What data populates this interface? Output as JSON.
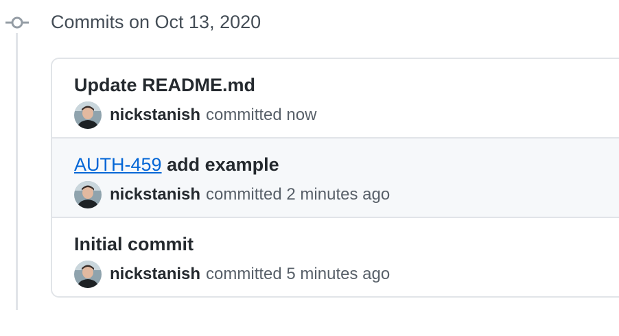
{
  "group": {
    "title": "Commits on Oct 13, 2020",
    "icon": "git-commit-icon"
  },
  "colors": {
    "link": "#0366d6",
    "border": "#e1e4e8",
    "highlight_bg": "#f6f8fa",
    "muted_text": "#586069"
  },
  "commits": [
    {
      "link_text": "",
      "title": "Update README.md",
      "author": "nickstanish",
      "committed_text": "committed now"
    },
    {
      "link_text": "AUTH-459",
      "title": "add example",
      "author": "nickstanish",
      "committed_text": "committed 2 minutes ago"
    },
    {
      "link_text": "",
      "title": "Initial commit",
      "author": "nickstanish",
      "committed_text": "committed 5 minutes ago"
    }
  ]
}
